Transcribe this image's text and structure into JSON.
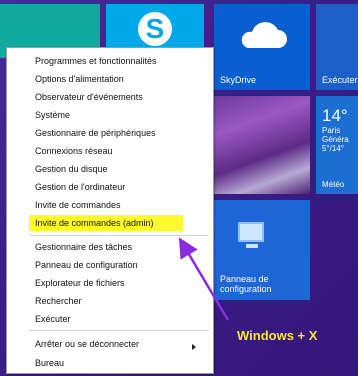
{
  "tiles": {
    "skydrive": "SkyDrive",
    "execute": "Exécuter",
    "control_panel": "Panneau de configuration",
    "weather": {
      "temp": "14°",
      "city": "Paris",
      "desc": "Généra",
      "range": "5°/14°",
      "app": "Météo"
    }
  },
  "menu": {
    "items": [
      "Programmes et fonctionnalités",
      "Options d'alimentation",
      "Observateur d'événements",
      "Système",
      "Gestionnaire de périphériques",
      "Connexions réseau",
      "Gestion du disque",
      "Gestion de l'ordinateur",
      "Invite de commandes",
      "Invite de commandes (admin)",
      "Gestionnaire des tâches",
      "Panneau de configuration",
      "Explorateur de fichiers",
      "Rechercher",
      "Exécuter",
      "Arrêter ou se déconnecter",
      "Bureau"
    ]
  },
  "caption": "Windows + X",
  "colors": {
    "highlight": "#fffb2a",
    "arrow": "#8a2be2",
    "caption": "#ffe430"
  }
}
